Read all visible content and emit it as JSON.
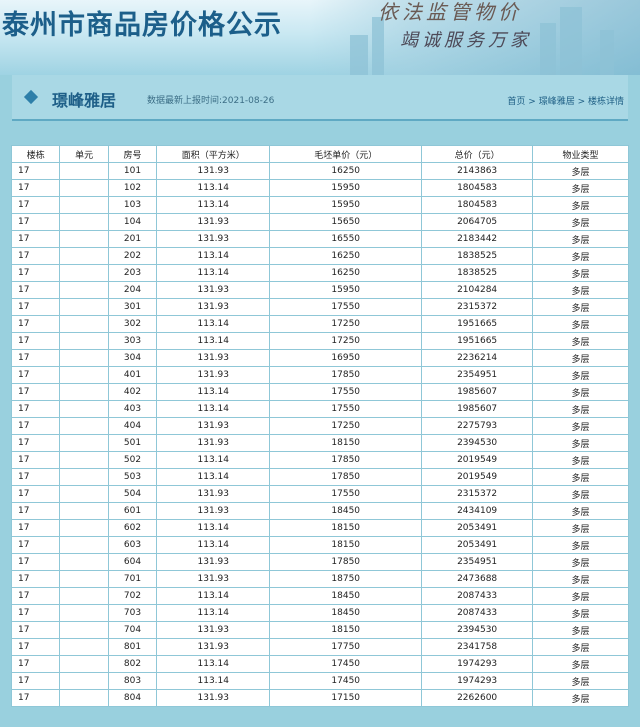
{
  "banner": {
    "title": "泰州市商品房价格公示",
    "slogan_top": "依法监管物价",
    "slogan_bottom": "竭诚服务万家"
  },
  "header": {
    "project_name": "璟峰雅居",
    "date_label": "数据最新上报时间:2021-08-26",
    "breadcrumb": [
      "首页",
      " > ",
      "璟峰雅居",
      " > ",
      "楼栋详情"
    ]
  },
  "table": {
    "columns": [
      "楼栋",
      "单元",
      "房号",
      "面积（平方米）",
      "毛坯单价（元）",
      "总价（元）",
      "物业类型"
    ],
    "rows": [
      [
        "17",
        "",
        "101",
        "131.93",
        "16250",
        "2143863",
        "多层"
      ],
      [
        "17",
        "",
        "102",
        "113.14",
        "15950",
        "1804583",
        "多层"
      ],
      [
        "17",
        "",
        "103",
        "113.14",
        "15950",
        "1804583",
        "多层"
      ],
      [
        "17",
        "",
        "104",
        "131.93",
        "15650",
        "2064705",
        "多层"
      ],
      [
        "17",
        "",
        "201",
        "131.93",
        "16550",
        "2183442",
        "多层"
      ],
      [
        "17",
        "",
        "202",
        "113.14",
        "16250",
        "1838525",
        "多层"
      ],
      [
        "17",
        "",
        "203",
        "113.14",
        "16250",
        "1838525",
        "多层"
      ],
      [
        "17",
        "",
        "204",
        "131.93",
        "15950",
        "2104284",
        "多层"
      ],
      [
        "17",
        "",
        "301",
        "131.93",
        "17550",
        "2315372",
        "多层"
      ],
      [
        "17",
        "",
        "302",
        "113.14",
        "17250",
        "1951665",
        "多层"
      ],
      [
        "17",
        "",
        "303",
        "113.14",
        "17250",
        "1951665",
        "多层"
      ],
      [
        "17",
        "",
        "304",
        "131.93",
        "16950",
        "2236214",
        "多层"
      ],
      [
        "17",
        "",
        "401",
        "131.93",
        "17850",
        "2354951",
        "多层"
      ],
      [
        "17",
        "",
        "402",
        "113.14",
        "17550",
        "1985607",
        "多层"
      ],
      [
        "17",
        "",
        "403",
        "113.14",
        "17550",
        "1985607",
        "多层"
      ],
      [
        "17",
        "",
        "404",
        "131.93",
        "17250",
        "2275793",
        "多层"
      ],
      [
        "17",
        "",
        "501",
        "131.93",
        "18150",
        "2394530",
        "多层"
      ],
      [
        "17",
        "",
        "502",
        "113.14",
        "17850",
        "2019549",
        "多层"
      ],
      [
        "17",
        "",
        "503",
        "113.14",
        "17850",
        "2019549",
        "多层"
      ],
      [
        "17",
        "",
        "504",
        "131.93",
        "17550",
        "2315372",
        "多层"
      ],
      [
        "17",
        "",
        "601",
        "131.93",
        "18450",
        "2434109",
        "多层"
      ],
      [
        "17",
        "",
        "602",
        "113.14",
        "18150",
        "2053491",
        "多层"
      ],
      [
        "17",
        "",
        "603",
        "113.14",
        "18150",
        "2053491",
        "多层"
      ],
      [
        "17",
        "",
        "604",
        "131.93",
        "17850",
        "2354951",
        "多层"
      ],
      [
        "17",
        "",
        "701",
        "131.93",
        "18750",
        "2473688",
        "多层"
      ],
      [
        "17",
        "",
        "702",
        "113.14",
        "18450",
        "2087433",
        "多层"
      ],
      [
        "17",
        "",
        "703",
        "113.14",
        "18450",
        "2087433",
        "多层"
      ],
      [
        "17",
        "",
        "704",
        "131.93",
        "18150",
        "2394530",
        "多层"
      ],
      [
        "17",
        "",
        "801",
        "131.93",
        "17750",
        "2341758",
        "多层"
      ],
      [
        "17",
        "",
        "802",
        "113.14",
        "17450",
        "1974293",
        "多层"
      ],
      [
        "17",
        "",
        "803",
        "113.14",
        "17450",
        "1974293",
        "多层"
      ],
      [
        "17",
        "",
        "804",
        "131.93",
        "17150",
        "2262600",
        "多层"
      ]
    ]
  }
}
